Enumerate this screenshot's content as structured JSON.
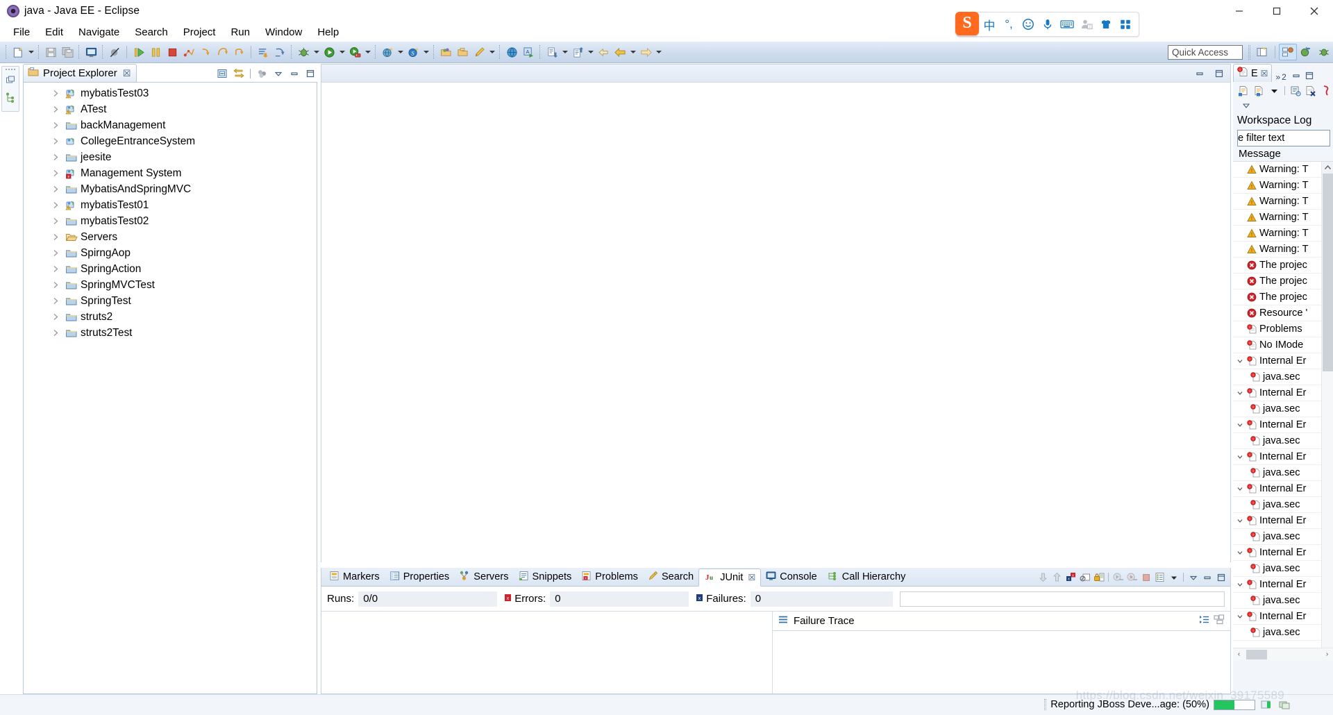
{
  "window": {
    "title": "java - Java EE - Eclipse",
    "icon": "eclipse-icon",
    "minimize": "─",
    "maximize": "□",
    "close": "✕"
  },
  "menubar": {
    "items": [
      {
        "label": "File"
      },
      {
        "label": "Edit"
      },
      {
        "label": "Navigate"
      },
      {
        "label": "Search"
      },
      {
        "label": "Project"
      },
      {
        "label": "Run"
      },
      {
        "label": "Window"
      },
      {
        "label": "Help"
      }
    ]
  },
  "ime_tray": {
    "logo": "S",
    "items": [
      {
        "name": "chinese-mode-icon",
        "glyph": "中"
      },
      {
        "name": "punctuation-icon",
        "glyph": "°,"
      },
      {
        "name": "emoji-icon",
        "glyph": "☺"
      },
      {
        "name": "microphone-icon",
        "glyph": "mic"
      },
      {
        "name": "keyboard-icon",
        "glyph": "kbd"
      },
      {
        "name": "user-icon",
        "glyph": "user"
      },
      {
        "name": "skin-icon",
        "glyph": "shirt"
      },
      {
        "name": "toolbox-icon",
        "glyph": "grid"
      }
    ]
  },
  "toolbar": {
    "quick_access_placeholder": "Quick Access",
    "buttons": [
      {
        "name": "new-wizard-button",
        "icon": "new-file-icon",
        "dropdown": true
      },
      {
        "name": "save-button",
        "icon": "save-icon",
        "dropdown": false
      },
      {
        "name": "save-all-button",
        "icon": "save-all-icon",
        "dropdown": false
      },
      {
        "name": "new-console-button",
        "icon": "console-icon",
        "dropdown": false
      },
      {
        "name": "skip-breakpoints-button",
        "icon": "skip-breakpoints-icon",
        "dropdown": false
      },
      {
        "name": "resume-button",
        "icon": "resume-icon",
        "dropdown": false
      },
      {
        "name": "suspend-button",
        "icon": "suspend-icon",
        "dropdown": false
      },
      {
        "name": "terminate-button",
        "icon": "terminate-icon",
        "dropdown": false
      },
      {
        "name": "disconnect-button",
        "icon": "disconnect-icon",
        "dropdown": false
      },
      {
        "name": "step-into-button",
        "icon": "step-into-icon",
        "dropdown": false
      },
      {
        "name": "step-over-button",
        "icon": "step-over-icon",
        "dropdown": false
      },
      {
        "name": "step-return-button",
        "icon": "step-return-icon",
        "dropdown": false
      },
      {
        "name": "drop-to-frame-button",
        "icon": "drop-to-frame-icon",
        "dropdown": false
      },
      {
        "name": "use-step-filters-button",
        "icon": "step-filters-icon",
        "dropdown": false
      },
      {
        "name": "debug-button",
        "icon": "bug-icon",
        "dropdown": true
      },
      {
        "name": "run-button",
        "icon": "run-icon",
        "dropdown": true
      },
      {
        "name": "run-on-server-button",
        "icon": "run-server-icon",
        "dropdown": true
      },
      {
        "name": "new-java-project-button",
        "icon": "java-project-icon",
        "dropdown": true
      },
      {
        "name": "new-spring-button",
        "icon": "spring-icon",
        "dropdown": true
      },
      {
        "name": "open-type-button",
        "icon": "open-type-icon",
        "dropdown": false
      },
      {
        "name": "open-task-button",
        "icon": "open-task-icon",
        "dropdown": false
      },
      {
        "name": "edit-pencil-button",
        "icon": "pencil-icon",
        "dropdown": true
      },
      {
        "name": "open-web-browser-button",
        "icon": "globe-icon",
        "dropdown": false
      },
      {
        "name": "run-last-tool-button",
        "icon": "run-tool-icon",
        "dropdown": false
      },
      {
        "name": "next-annotation-button",
        "icon": "next-annotation-icon",
        "dropdown": true
      },
      {
        "name": "previous-annotation-button",
        "icon": "prev-annotation-icon",
        "dropdown": true
      },
      {
        "name": "back-button",
        "icon": "back-arrow-icon",
        "dropdown": false
      },
      {
        "name": "backward-history-button",
        "icon": "backward-arrow-icon",
        "dropdown": true
      },
      {
        "name": "forward-history-button",
        "icon": "forward-arrow-icon",
        "dropdown": true
      }
    ],
    "perspective_buttons": [
      {
        "name": "open-perspective-button",
        "icon": "open-perspective-icon",
        "active": false
      },
      {
        "name": "perspective-java-ee",
        "icon": "java-ee-perspective-icon",
        "active": true
      },
      {
        "name": "perspective-java",
        "icon": "java-perspective-icon",
        "active": false
      },
      {
        "name": "perspective-debug",
        "icon": "debug-perspective-icon",
        "active": false
      }
    ]
  },
  "project_explorer": {
    "tab_label": "Project Explorer",
    "tab_icon": "project-explorer-icon",
    "close_glyph": "☒",
    "toolbar": [
      {
        "name": "collapse-all-button",
        "icon": "collapse-all-icon"
      },
      {
        "name": "link-with-editor-button",
        "icon": "link-editor-icon"
      },
      {
        "name": "view-menu-button",
        "icon": "view-menu-icon"
      },
      {
        "name": "view-dropdown-button",
        "icon": "chevron-down-icon"
      },
      {
        "name": "minimize-view-button",
        "icon": "minimize-icon"
      },
      {
        "name": "maximize-view-button",
        "icon": "maximize-icon"
      }
    ],
    "tree": [
      {
        "label": "mybatisTest03",
        "icon": "java-project-warning-icon",
        "expandable": true
      },
      {
        "label": "ATest",
        "icon": "java-project-warning-icon",
        "expandable": true
      },
      {
        "label": "backManagement",
        "icon": "folder-icon",
        "expandable": true
      },
      {
        "label": "CollegeEntranceSystem",
        "icon": "java-project-icon",
        "expandable": true
      },
      {
        "label": "jeesite",
        "icon": "folder-icon",
        "expandable": true
      },
      {
        "label": "Management System",
        "icon": "java-project-error-icon",
        "expandable": true
      },
      {
        "label": "MybatisAndSpringMVC",
        "icon": "folder-icon",
        "expandable": true
      },
      {
        "label": "mybatisTest01",
        "icon": "java-project-warning-icon",
        "expandable": true
      },
      {
        "label": "mybatisTest02",
        "icon": "folder-icon",
        "expandable": true
      },
      {
        "label": "Servers",
        "icon": "open-folder-icon",
        "expandable": true
      },
      {
        "label": "SpirngAop",
        "icon": "folder-icon",
        "expandable": true
      },
      {
        "label": "SpringAction",
        "icon": "folder-icon",
        "expandable": true
      },
      {
        "label": "SpringMVCTest",
        "icon": "folder-icon",
        "expandable": true
      },
      {
        "label": "SpringTest",
        "icon": "folder-icon",
        "expandable": true
      },
      {
        "label": "struts2",
        "icon": "folder-icon",
        "expandable": true
      },
      {
        "label": "struts2Test",
        "icon": "folder-icon",
        "expandable": true
      }
    ]
  },
  "editor": {
    "buttons": [
      {
        "name": "minimize-editor-button",
        "icon": "minimize-icon"
      },
      {
        "name": "maximize-editor-button",
        "icon": "maximize-icon"
      }
    ]
  },
  "bottom_panel": {
    "tabs": [
      {
        "label": "Markers",
        "icon": "markers-icon",
        "active": false,
        "closable": false
      },
      {
        "label": "Properties",
        "icon": "properties-icon",
        "active": false,
        "closable": false
      },
      {
        "label": "Servers",
        "icon": "servers-icon",
        "active": false,
        "closable": false
      },
      {
        "label": "Snippets",
        "icon": "snippets-icon",
        "active": false,
        "closable": false
      },
      {
        "label": "Problems",
        "icon": "problems-icon",
        "active": false,
        "closable": false
      },
      {
        "label": "Search",
        "icon": "search-icon",
        "active": false,
        "closable": false
      },
      {
        "label": "JUnit",
        "icon": "junit-icon",
        "active": true,
        "closable": true
      },
      {
        "label": "Console",
        "icon": "console-icon",
        "active": false,
        "closable": false
      },
      {
        "label": "Call Hierarchy",
        "icon": "call-hierarchy-icon",
        "active": false,
        "closable": false
      }
    ],
    "close_glyph": "☒",
    "toolbar": [
      {
        "name": "next-failure-button",
        "icon": "arrow-down-icon"
      },
      {
        "name": "previous-failure-button",
        "icon": "arrow-up-icon"
      },
      {
        "name": "show-failures-only-button",
        "icon": "show-failures-icon"
      },
      {
        "name": "stop-junit-button",
        "icon": "stop-circle-icon"
      },
      {
        "name": "lock-scroll-button",
        "icon": "lock-icon"
      },
      {
        "name": "rerun-test-button",
        "icon": "rerun-icon"
      },
      {
        "name": "rerun-failed-button",
        "icon": "rerun-failed-icon"
      },
      {
        "name": "terminate-button",
        "icon": "terminate-icon"
      },
      {
        "name": "test-history-button",
        "icon": "history-icon"
      },
      {
        "name": "history-dropdown-button",
        "icon": "chevron-down-icon"
      },
      {
        "name": "view-menu-button",
        "icon": "view-menu-icon"
      },
      {
        "name": "minimize-panel-button",
        "icon": "minimize-icon"
      },
      {
        "name": "maximize-panel-button",
        "icon": "maximize-icon"
      }
    ],
    "junit": {
      "runs_label": "Runs:",
      "runs_value": "0/0",
      "errors_label": "Errors:",
      "errors_value": "0",
      "errors_icon": "error-marker-icon",
      "failures_label": "Failures:",
      "failures_value": "0",
      "failures_icon": "failure-marker-icon",
      "failure_trace_label": "Failure Trace",
      "failure_trace_icon": "stack-icon",
      "failure_trace_tools": [
        {
          "name": "filter-stack-trace-button",
          "icon": "filter-stack-icon"
        },
        {
          "name": "compare-result-button",
          "icon": "compare-icon"
        }
      ]
    }
  },
  "error_log": {
    "tab_label": "E",
    "tab_icon": "error-log-icon",
    "close_glyph": "☒",
    "overflow_glyph": "»",
    "overflow_count": "2",
    "window_buttons": [
      {
        "name": "minimize-view-button",
        "icon": "minimize-icon"
      },
      {
        "name": "maximize-view-button",
        "icon": "maximize-icon"
      }
    ],
    "toolbar": [
      {
        "name": "export-log-button",
        "icon": "export-log-icon"
      },
      {
        "name": "import-log-button",
        "icon": "import-log-icon"
      },
      {
        "name": "filters-dropdown-button",
        "icon": "chevron-down-icon"
      },
      {
        "name": "open-log-button",
        "icon": "open-log-icon"
      },
      {
        "name": "clear-log-viewer-button",
        "icon": "clear-log-icon"
      },
      {
        "name": "restore-log-button",
        "icon": "restore-log-icon"
      },
      {
        "name": "view-menu-button",
        "icon": "view-menu-icon"
      }
    ],
    "title": "Workspace Log",
    "filter_text": "e filter text",
    "column_header": "Message",
    "entries": [
      {
        "text": "Warning: T",
        "icon": "warning-icon",
        "level": 0,
        "expanded": null
      },
      {
        "text": "Warning: T",
        "icon": "warning-icon",
        "level": 0,
        "expanded": null
      },
      {
        "text": "Warning: T",
        "icon": "warning-icon",
        "level": 0,
        "expanded": null
      },
      {
        "text": "Warning: T",
        "icon": "warning-icon",
        "level": 0,
        "expanded": null
      },
      {
        "text": "Warning: T",
        "icon": "warning-icon",
        "level": 0,
        "expanded": null
      },
      {
        "text": "Warning: T",
        "icon": "warning-icon",
        "level": 0,
        "expanded": null
      },
      {
        "text": "The projec",
        "icon": "error-icon",
        "level": 0,
        "expanded": null
      },
      {
        "text": "The projec",
        "icon": "error-icon",
        "level": 0,
        "expanded": null
      },
      {
        "text": "The projec",
        "icon": "error-icon",
        "level": 0,
        "expanded": null
      },
      {
        "text": "Resource '",
        "icon": "error-icon",
        "level": 0,
        "expanded": null
      },
      {
        "text": "Problems ",
        "icon": "log-error-icon",
        "level": 0,
        "expanded": null
      },
      {
        "text": "No IMode",
        "icon": "log-error-icon",
        "level": 0,
        "expanded": null
      },
      {
        "text": "Internal Er",
        "icon": "log-error-icon",
        "level": 0,
        "expanded": true
      },
      {
        "text": "java.sec",
        "icon": "log-error-icon",
        "level": 1,
        "expanded": null
      },
      {
        "text": "Internal Er",
        "icon": "log-error-icon",
        "level": 0,
        "expanded": true
      },
      {
        "text": "java.sec",
        "icon": "log-error-icon",
        "level": 1,
        "expanded": null
      },
      {
        "text": "Internal Er",
        "icon": "log-error-icon",
        "level": 0,
        "expanded": true
      },
      {
        "text": "java.sec",
        "icon": "log-error-icon",
        "level": 1,
        "expanded": null
      },
      {
        "text": "Internal Er",
        "icon": "log-error-icon",
        "level": 0,
        "expanded": true
      },
      {
        "text": "java.sec",
        "icon": "log-error-icon",
        "level": 1,
        "expanded": null
      },
      {
        "text": "Internal Er",
        "icon": "log-error-icon",
        "level": 0,
        "expanded": true
      },
      {
        "text": "java.sec",
        "icon": "log-error-icon",
        "level": 1,
        "expanded": null
      },
      {
        "text": "Internal Er",
        "icon": "log-error-icon",
        "level": 0,
        "expanded": true
      },
      {
        "text": "java.sec",
        "icon": "log-error-icon",
        "level": 1,
        "expanded": null
      },
      {
        "text": "Internal Er",
        "icon": "log-error-icon",
        "level": 0,
        "expanded": true
      },
      {
        "text": "java.sec",
        "icon": "log-error-icon",
        "level": 1,
        "expanded": null
      },
      {
        "text": "Internal Er",
        "icon": "log-error-icon",
        "level": 0,
        "expanded": true
      },
      {
        "text": "java.sec",
        "icon": "log-error-icon",
        "level": 1,
        "expanded": null
      },
      {
        "text": "Internal Er",
        "icon": "log-error-icon",
        "level": 0,
        "expanded": true
      },
      {
        "text": "java.sec",
        "icon": "log-error-icon",
        "level": 1,
        "expanded": null
      }
    ],
    "scroll_left_glyph": "‹",
    "scroll_right_glyph": "›",
    "scroll_up_glyph": "⌃"
  },
  "status_bar": {
    "progress_text": "Reporting JBoss Deve...age: (50%)",
    "progress_percent": 50,
    "icons": [
      {
        "name": "progress-bar",
        "icon": "progress-icon"
      },
      {
        "name": "stop-job-button",
        "icon": "stop-job-icon"
      },
      {
        "name": "show-jobs-button",
        "icon": "jobs-icon"
      }
    ]
  },
  "watermark": "https://blog.csdn.net/weixin_39175589",
  "colors": {
    "toolbar_top": "#e3ecf7",
    "toolbar_bottom": "#c5d5ea",
    "tab_border": "#b8c8dc",
    "accent_blue": "#1878c8",
    "warning_yellow": "#f0ad20",
    "error_red": "#d0232b",
    "progress_green": "#22c55e",
    "ime_orange": "#ff6a1f"
  }
}
